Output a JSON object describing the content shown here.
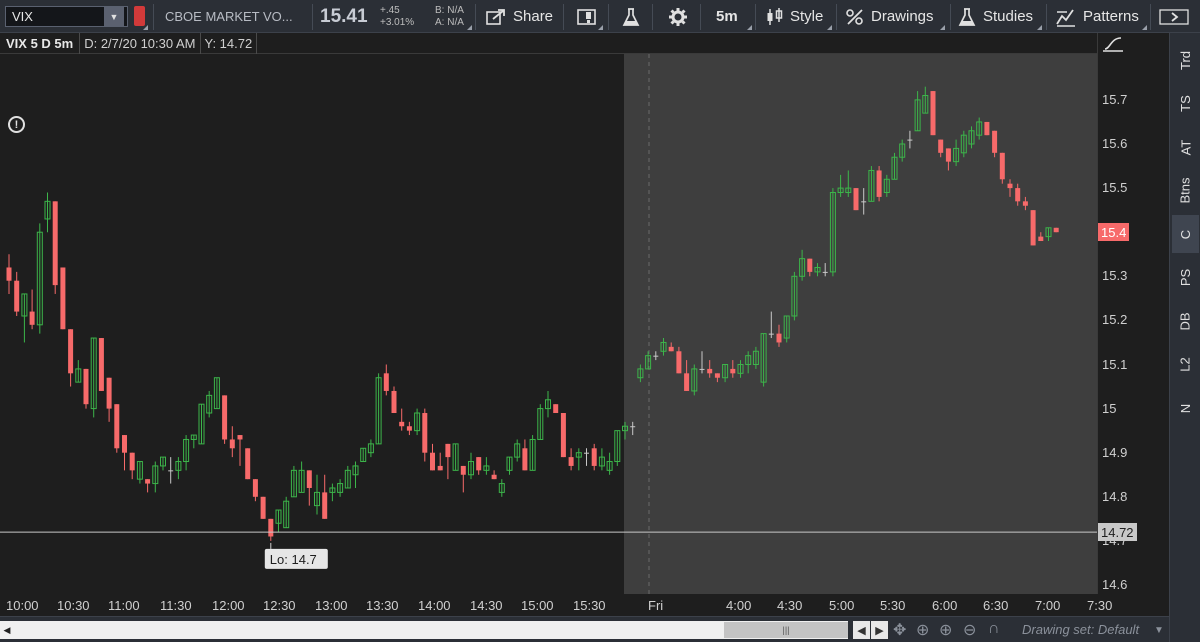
{
  "toolbar": {
    "symbol": "VIX",
    "description": "CBOE MARKET VO...",
    "last": "15.41",
    "change": "+.45",
    "change_pct": "+3.01%",
    "bid": "B: N/A",
    "ask": "A: N/A",
    "share_label": "Share",
    "timeframe_label": "5m",
    "style_label": "Style",
    "drawings_label": "Drawings",
    "studies_label": "Studies",
    "patterns_label": "Patterns"
  },
  "header": {
    "title": "VIX 5 D 5m",
    "date": "D: 2/7/20 10:30 AM",
    "value": "Y: 14.72"
  },
  "price_axis": {
    "ticks": [
      "15.7",
      "15.6",
      "15.5",
      "15.4",
      "15.3",
      "15.2",
      "15.1",
      "15",
      "14.9",
      "14.8",
      "14.7",
      "14.6"
    ],
    "last_tag": "15.4",
    "crosshair_tag": "14.72"
  },
  "time_axis": {
    "labels": [
      "10:00",
      "10:30",
      "11:00",
      "11:30",
      "12:00",
      "12:30",
      "13:00",
      "13:30",
      "14:00",
      "14:30",
      "15:00",
      "15:30",
      "Fri",
      "4:00",
      "4:30",
      "5:00",
      "5:30",
      "6:00",
      "6:30",
      "7:00",
      "7:30"
    ]
  },
  "annotations": {
    "low_label": "Lo: 14.7"
  },
  "side_tabs": [
    "Trd",
    "TS",
    "AT",
    "Btns",
    "C",
    "PS",
    "DB",
    "L2",
    "N"
  ],
  "side_tab_active": "C",
  "bottom": {
    "drawing_set": "Drawing set: Default"
  },
  "colors": {
    "up": "#3cb54a",
    "down": "#f76a6a",
    "doji": "#c8c8c8",
    "session_shade": "#3e3e3e"
  },
  "chart_data": {
    "type": "candlestick",
    "symbol": "VIX",
    "interval": "5m",
    "ylim": [
      14.6,
      15.75
    ],
    "crosshair_y": 14.72,
    "low_marker": 14.7,
    "last_price": 15.4,
    "candles": [
      {
        "o": 15.32,
        "h": 15.35,
        "l": 15.26,
        "c": 15.29
      },
      {
        "o": 15.29,
        "h": 15.31,
        "l": 15.21,
        "c": 15.22
      },
      {
        "o": 15.21,
        "h": 15.26,
        "l": 15.15,
        "c": 15.26
      },
      {
        "o": 15.22,
        "h": 15.27,
        "l": 15.18,
        "c": 15.19
      },
      {
        "o": 15.19,
        "h": 15.42,
        "l": 15.17,
        "c": 15.4
      },
      {
        "o": 15.43,
        "h": 15.49,
        "l": 15.4,
        "c": 15.47
      },
      {
        "o": 15.47,
        "h": 15.47,
        "l": 15.26,
        "c": 15.28
      },
      {
        "o": 15.32,
        "h": 15.32,
        "l": 15.18,
        "c": 15.18
      },
      {
        "o": 15.18,
        "h": 15.18,
        "l": 15.05,
        "c": 15.08
      },
      {
        "o": 15.06,
        "h": 15.11,
        "l": 15.06,
        "c": 15.09
      },
      {
        "o": 15.09,
        "h": 15.09,
        "l": 15.0,
        "c": 15.01
      },
      {
        "o": 15.0,
        "h": 15.16,
        "l": 14.98,
        "c": 15.16
      },
      {
        "o": 15.16,
        "h": 15.16,
        "l": 15.04,
        "c": 15.04
      },
      {
        "o": 15.07,
        "h": 15.07,
        "l": 14.97,
        "c": 15.0
      },
      {
        "o": 15.01,
        "h": 15.01,
        "l": 14.9,
        "c": 14.91
      },
      {
        "o": 14.94,
        "h": 14.94,
        "l": 14.86,
        "c": 14.9
      },
      {
        "o": 14.9,
        "h": 14.9,
        "l": 14.84,
        "c": 14.86
      },
      {
        "o": 14.84,
        "h": 14.88,
        "l": 14.83,
        "c": 14.88
      },
      {
        "o": 14.84,
        "h": 14.82,
        "l": 14.81,
        "c": 14.83
      },
      {
        "o": 14.83,
        "h": 14.88,
        "l": 14.81,
        "c": 14.87
      },
      {
        "o": 14.87,
        "h": 14.89,
        "l": 14.86,
        "c": 14.89
      },
      {
        "o": 14.86,
        "h": 14.89,
        "l": 14.83,
        "c": 14.86
      },
      {
        "o": 14.86,
        "h": 14.89,
        "l": 14.84,
        "c": 14.88
      },
      {
        "o": 14.88,
        "h": 14.94,
        "l": 14.86,
        "c": 14.93
      },
      {
        "o": 14.93,
        "h": 14.94,
        "l": 14.91,
        "c": 14.94
      },
      {
        "o": 14.92,
        "h": 15.01,
        "l": 14.92,
        "c": 15.01
      },
      {
        "o": 14.99,
        "h": 15.04,
        "l": 14.98,
        "c": 15.03
      },
      {
        "o": 15.0,
        "h": 15.07,
        "l": 15.0,
        "c": 15.07
      },
      {
        "o": 15.03,
        "h": 15.03,
        "l": 14.92,
        "c": 14.93
      },
      {
        "o": 14.93,
        "h": 14.96,
        "l": 14.89,
        "c": 14.91
      },
      {
        "o": 14.94,
        "h": 14.94,
        "l": 14.87,
        "c": 14.93
      },
      {
        "o": 14.91,
        "h": 14.91,
        "l": 14.84,
        "c": 14.84
      },
      {
        "o": 14.84,
        "h": 14.82,
        "l": 14.79,
        "c": 14.8
      },
      {
        "o": 14.8,
        "h": 14.8,
        "l": 14.75,
        "c": 14.75
      },
      {
        "o": 14.75,
        "h": 14.75,
        "l": 14.7,
        "c": 14.71
      },
      {
        "o": 14.74,
        "h": 14.77,
        "l": 14.72,
        "c": 14.77
      },
      {
        "o": 14.73,
        "h": 14.8,
        "l": 14.73,
        "c": 14.79
      },
      {
        "o": 14.8,
        "h": 14.87,
        "l": 14.8,
        "c": 14.86
      },
      {
        "o": 14.81,
        "h": 14.88,
        "l": 14.81,
        "c": 14.86
      },
      {
        "o": 14.86,
        "h": 14.86,
        "l": 14.78,
        "c": 14.82
      },
      {
        "o": 14.78,
        "h": 14.85,
        "l": 14.76,
        "c": 14.81
      },
      {
        "o": 14.81,
        "h": 14.85,
        "l": 14.75,
        "c": 14.75
      },
      {
        "o": 14.81,
        "h": 14.83,
        "l": 14.79,
        "c": 14.82
      },
      {
        "o": 14.81,
        "h": 14.84,
        "l": 14.8,
        "c": 14.83
      },
      {
        "o": 14.82,
        "h": 14.87,
        "l": 14.82,
        "c": 14.86
      },
      {
        "o": 14.85,
        "h": 14.88,
        "l": 14.82,
        "c": 14.87
      },
      {
        "o": 14.88,
        "h": 14.91,
        "l": 14.88,
        "c": 14.91
      },
      {
        "o": 14.9,
        "h": 14.93,
        "l": 14.89,
        "c": 14.92
      },
      {
        "o": 14.92,
        "h": 15.08,
        "l": 14.92,
        "c": 15.07
      },
      {
        "o": 15.08,
        "h": 15.1,
        "l": 15.03,
        "c": 15.04
      },
      {
        "o": 15.04,
        "h": 15.05,
        "l": 14.99,
        "c": 14.99
      },
      {
        "o": 14.97,
        "h": 15.0,
        "l": 14.95,
        "c": 14.96
      },
      {
        "o": 14.96,
        "h": 14.97,
        "l": 14.94,
        "c": 14.95
      },
      {
        "o": 14.95,
        "h": 15.0,
        "l": 14.94,
        "c": 14.99
      },
      {
        "o": 14.99,
        "h": 15.0,
        "l": 14.88,
        "c": 14.9
      },
      {
        "o": 14.9,
        "h": 14.92,
        "l": 14.86,
        "c": 14.86
      },
      {
        "o": 14.87,
        "h": 14.9,
        "l": 14.86,
        "c": 14.86
      },
      {
        "o": 14.92,
        "h": 14.92,
        "l": 14.84,
        "c": 14.89
      },
      {
        "o": 14.86,
        "h": 14.92,
        "l": 14.86,
        "c": 14.92
      },
      {
        "o": 14.87,
        "h": 14.87,
        "l": 14.81,
        "c": 14.85
      },
      {
        "o": 14.85,
        "h": 14.9,
        "l": 14.84,
        "c": 14.88
      },
      {
        "o": 14.89,
        "h": 14.89,
        "l": 14.85,
        "c": 14.86
      },
      {
        "o": 14.86,
        "h": 14.89,
        "l": 14.85,
        "c": 14.87
      },
      {
        "o": 14.85,
        "h": 14.86,
        "l": 14.84,
        "c": 14.84
      },
      {
        "o": 14.81,
        "h": 14.84,
        "l": 14.8,
        "c": 14.83
      },
      {
        "o": 14.86,
        "h": 14.89,
        "l": 14.85,
        "c": 14.89
      },
      {
        "o": 14.89,
        "h": 14.93,
        "l": 14.88,
        "c": 14.92
      },
      {
        "o": 14.91,
        "h": 14.93,
        "l": 14.86,
        "c": 14.86
      },
      {
        "o": 14.86,
        "h": 14.94,
        "l": 14.86,
        "c": 14.93
      },
      {
        "o": 14.93,
        "h": 15.01,
        "l": 14.93,
        "c": 15.0
      },
      {
        "o": 15.0,
        "h": 15.04,
        "l": 14.98,
        "c": 15.02
      },
      {
        "o": 15.01,
        "h": 15.01,
        "l": 14.99,
        "c": 14.99
      },
      {
        "o": 14.99,
        "h": 14.99,
        "l": 14.89,
        "c": 14.89
      },
      {
        "o": 14.89,
        "h": 14.91,
        "l": 14.86,
        "c": 14.87
      },
      {
        "o": 14.89,
        "h": 14.91,
        "l": 14.86,
        "c": 14.9
      },
      {
        "o": 14.9,
        "h": 14.91,
        "l": 14.87,
        "c": 14.9
      },
      {
        "o": 14.91,
        "h": 14.92,
        "l": 14.86,
        "c": 14.87
      },
      {
        "o": 14.87,
        "h": 14.91,
        "l": 14.86,
        "c": 14.89
      },
      {
        "o": 14.86,
        "h": 14.9,
        "l": 14.85,
        "c": 14.88
      },
      {
        "o": 14.88,
        "h": 14.95,
        "l": 14.87,
        "c": 14.95
      },
      {
        "o": 14.95,
        "h": 14.97,
        "l": 14.93,
        "c": 14.96
      },
      {
        "o": 14.96,
        "h": 14.97,
        "l": 14.94,
        "c": 14.96
      },
      {
        "o": 15.07,
        "h": 15.1,
        "l": 15.06,
        "c": 15.09
      },
      {
        "o": 15.09,
        "h": 15.13,
        "l": 15.09,
        "c": 15.12
      },
      {
        "o": 15.12,
        "h": 15.13,
        "l": 15.11,
        "c": 15.12
      },
      {
        "o": 15.13,
        "h": 15.16,
        "l": 15.12,
        "c": 15.15
      },
      {
        "o": 15.14,
        "h": 15.15,
        "l": 15.13,
        "c": 15.13
      },
      {
        "o": 15.13,
        "h": 15.14,
        "l": 15.08,
        "c": 15.08
      },
      {
        "o": 15.08,
        "h": 15.11,
        "l": 15.04,
        "c": 15.04
      },
      {
        "o": 15.04,
        "h": 15.1,
        "l": 15.03,
        "c": 15.09
      },
      {
        "o": 15.09,
        "h": 15.13,
        "l": 15.08,
        "c": 15.09
      },
      {
        "o": 15.09,
        "h": 15.11,
        "l": 15.07,
        "c": 15.08
      },
      {
        "o": 15.08,
        "h": 15.08,
        "l": 15.06,
        "c": 15.07
      },
      {
        "o": 15.07,
        "h": 15.1,
        "l": 15.06,
        "c": 15.1
      },
      {
        "o": 15.09,
        "h": 15.11,
        "l": 15.07,
        "c": 15.08
      },
      {
        "o": 15.08,
        "h": 15.11,
        "l": 15.07,
        "c": 15.1
      },
      {
        "o": 15.1,
        "h": 15.13,
        "l": 15.08,
        "c": 15.12
      },
      {
        "o": 15.1,
        "h": 15.14,
        "l": 15.09,
        "c": 15.13
      },
      {
        "o": 15.06,
        "h": 15.17,
        "l": 15.05,
        "c": 15.17
      },
      {
        "o": 15.17,
        "h": 15.22,
        "l": 15.16,
        "c": 15.17
      },
      {
        "o": 15.17,
        "h": 15.19,
        "l": 15.14,
        "c": 15.15
      },
      {
        "o": 15.16,
        "h": 15.21,
        "l": 15.15,
        "c": 15.21
      },
      {
        "o": 15.21,
        "h": 15.31,
        "l": 15.2,
        "c": 15.3
      },
      {
        "o": 15.3,
        "h": 15.36,
        "l": 15.29,
        "c": 15.34
      },
      {
        "o": 15.34,
        "h": 15.34,
        "l": 15.3,
        "c": 15.31
      },
      {
        "o": 15.31,
        "h": 15.33,
        "l": 15.3,
        "c": 15.32
      },
      {
        "o": 15.31,
        "h": 15.33,
        "l": 15.3,
        "c": 15.31
      },
      {
        "o": 15.31,
        "h": 15.5,
        "l": 15.3,
        "c": 15.49
      },
      {
        "o": 15.49,
        "h": 15.53,
        "l": 15.48,
        "c": 15.5
      },
      {
        "o": 15.49,
        "h": 15.54,
        "l": 15.48,
        "c": 15.5
      },
      {
        "o": 15.5,
        "h": 15.5,
        "l": 15.45,
        "c": 15.45
      },
      {
        "o": 15.47,
        "h": 15.5,
        "l": 15.44,
        "c": 15.47
      },
      {
        "o": 15.47,
        "h": 15.55,
        "l": 15.47,
        "c": 15.54
      },
      {
        "o": 15.54,
        "h": 15.55,
        "l": 15.47,
        "c": 15.48
      },
      {
        "o": 15.49,
        "h": 15.53,
        "l": 15.48,
        "c": 15.52
      },
      {
        "o": 15.52,
        "h": 15.58,
        "l": 15.52,
        "c": 15.57
      },
      {
        "o": 15.57,
        "h": 15.61,
        "l": 15.56,
        "c": 15.6
      },
      {
        "o": 15.61,
        "h": 15.63,
        "l": 15.59,
        "c": 15.61
      },
      {
        "o": 15.63,
        "h": 15.72,
        "l": 15.63,
        "c": 15.7
      },
      {
        "o": 15.67,
        "h": 15.73,
        "l": 15.67,
        "c": 15.71
      },
      {
        "o": 15.72,
        "h": 15.72,
        "l": 15.62,
        "c": 15.62
      },
      {
        "o": 15.61,
        "h": 15.61,
        "l": 15.57,
        "c": 15.58
      },
      {
        "o": 15.59,
        "h": 15.59,
        "l": 15.54,
        "c": 15.56
      },
      {
        "o": 15.56,
        "h": 15.61,
        "l": 15.55,
        "c": 15.59
      },
      {
        "o": 15.58,
        "h": 15.63,
        "l": 15.57,
        "c": 15.62
      },
      {
        "o": 15.6,
        "h": 15.64,
        "l": 15.59,
        "c": 15.63
      },
      {
        "o": 15.62,
        "h": 15.66,
        "l": 15.61,
        "c": 15.65
      },
      {
        "o": 15.65,
        "h": 15.65,
        "l": 15.62,
        "c": 15.62
      },
      {
        "o": 15.63,
        "h": 15.63,
        "l": 15.57,
        "c": 15.58
      },
      {
        "o": 15.58,
        "h": 15.58,
        "l": 15.51,
        "c": 15.52
      },
      {
        "o": 15.51,
        "h": 15.52,
        "l": 15.48,
        "c": 15.5
      },
      {
        "o": 15.5,
        "h": 15.51,
        "l": 15.46,
        "c": 15.47
      },
      {
        "o": 15.47,
        "h": 15.48,
        "l": 15.45,
        "c": 15.46
      },
      {
        "o": 15.45,
        "h": 15.45,
        "l": 15.37,
        "c": 15.37
      },
      {
        "o": 15.39,
        "h": 15.4,
        "l": 15.38,
        "c": 15.38
      },
      {
        "o": 15.39,
        "h": 15.41,
        "l": 15.38,
        "c": 15.41
      },
      {
        "o": 15.41,
        "h": 15.41,
        "l": 15.4,
        "c": 15.4
      }
    ]
  }
}
